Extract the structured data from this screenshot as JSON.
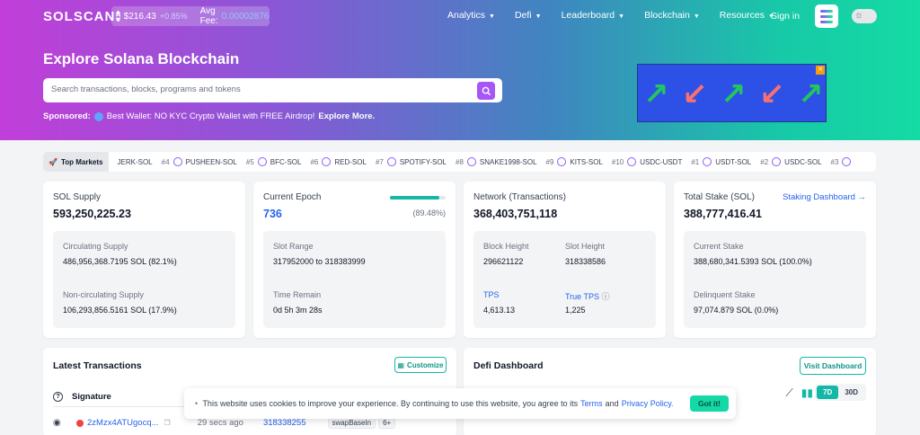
{
  "header": {
    "logo": "SOLSCAN",
    "sol_price": "$216.43",
    "sol_change": "+0.85%",
    "fee_label": "Avg Fee:",
    "fee_value": "0.00002876",
    "nav": [
      "Analytics",
      "Defi",
      "Leaderboard",
      "Blockchain",
      "Resources"
    ],
    "signin": "Sign in"
  },
  "hero": {
    "title": "Explore Solana Blockchain",
    "search_placeholder": "Search transactions, blocks, programs and tokens",
    "sponsored_label": "Sponsored:",
    "sponsored_text": "Best Wallet: NO KYC Crypto Wallet with FREE Airdrop!",
    "sponsored_link": "Explore More."
  },
  "ad": {
    "arrows": [
      "↗",
      "↙",
      "↗",
      "↙",
      "↗"
    ],
    "arrow_colors": [
      "#22c55e",
      "#f87171",
      "#22c55e",
      "#f87171",
      "#22c55e"
    ]
  },
  "markets": {
    "label": "Top Markets",
    "items": [
      {
        "rank": "",
        "pair": "JERK-SOL"
      },
      {
        "rank": "#4",
        "pair": "PUSHEEN-SOL"
      },
      {
        "rank": "#5",
        "pair": "BFC-SOL"
      },
      {
        "rank": "#6",
        "pair": "RED-SOL"
      },
      {
        "rank": "#7",
        "pair": "SPOTIFY-SOL"
      },
      {
        "rank": "#8",
        "pair": "SNAKE1998-SOL"
      },
      {
        "rank": "#9",
        "pair": "KITS-SOL"
      },
      {
        "rank": "#10",
        "pair": "USDC-USDT"
      },
      {
        "rank": "#1",
        "pair": "USDT-SOL"
      },
      {
        "rank": "#2",
        "pair": "USDC-SOL"
      },
      {
        "rank": "#3",
        "pair": ""
      }
    ]
  },
  "supply": {
    "title": "SOL Supply",
    "value": "593,250,225.23",
    "circ_label": "Circulating Supply",
    "circ_value": "486,956,368.7195 SOL (82.1%)",
    "noncirc_label": "Non-circulating Supply",
    "noncirc_value": "106,293,856.5161 SOL (17.9%)"
  },
  "epoch": {
    "title": "Current Epoch",
    "value": "736",
    "progress_text": "(89.48%)",
    "progress_fraction": 0.8948,
    "slot_label": "Slot Range",
    "slot_value": "317952000 to 318383999",
    "time_label": "Time Remain",
    "time_value": "0d 5h 3m 28s"
  },
  "network": {
    "title": "Network (Transactions)",
    "value": "368,403,751,118",
    "block_label": "Block Height",
    "block_value": "296621122",
    "slot_label": "Slot Height",
    "slot_value": "318338586",
    "tps_label": "TPS",
    "tps_value": "4,613.13",
    "true_tps_label": "True TPS",
    "true_tps_value": "1,225"
  },
  "stake": {
    "title": "Total Stake (SOL)",
    "link": "Staking Dashboard",
    "value": "388,777,416.41",
    "current_label": "Current Stake",
    "current_value": "388,680,341.5393 SOL (100.0%)",
    "delinquent_label": "Delinquent Stake",
    "delinquent_value": "97,074.879 SOL (0.0%)"
  },
  "transactions": {
    "title": "Latest Transactions",
    "customize": "Customize",
    "col_signature": "Signature",
    "row": {
      "signature": "2zMzx4ATUgocq...",
      "age": "29 secs ago",
      "block": "318338255",
      "instruction": "swapBaseIn",
      "more": "6+"
    }
  },
  "defi": {
    "title": "Defi Dashboard",
    "visit": "Visit Dashboard",
    "ranges": [
      "7D",
      "30D"
    ]
  },
  "cookie": {
    "text": "This website uses cookies to improve your experience. By continuing to use this website, you agree to its",
    "terms": "Terms",
    "and": "and",
    "privacy": "Privacy Policy.",
    "button": "Got it!"
  }
}
